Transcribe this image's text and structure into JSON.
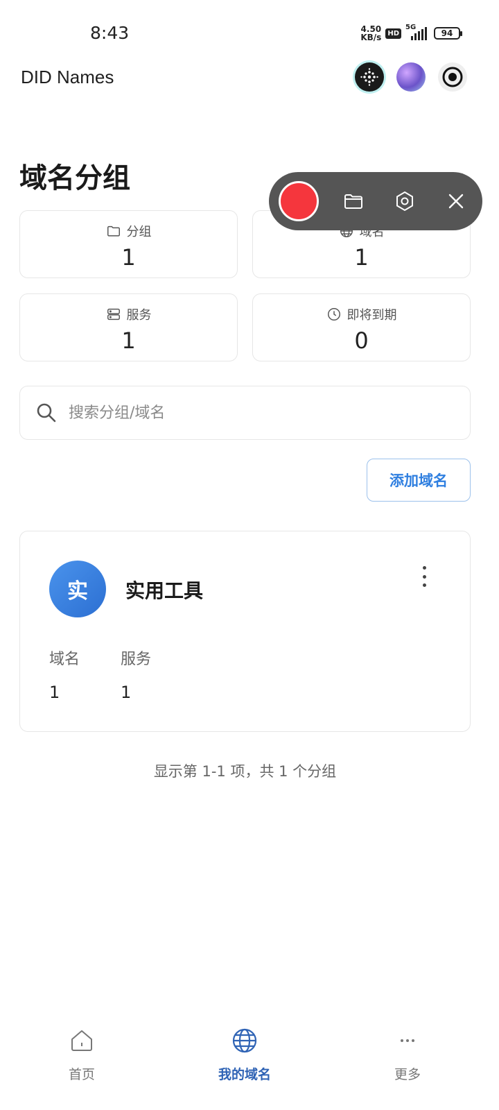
{
  "status_bar": {
    "time": "8:43",
    "net_speed_value": "4.50",
    "net_speed_unit": "KB/s",
    "hd": "HD",
    "network": "5G",
    "battery": "94"
  },
  "header": {
    "title": "DID Names",
    "icons": [
      "dots-app-icon",
      "avatar-icon",
      "record-icon"
    ]
  },
  "page": {
    "title": "域名分组"
  },
  "stats": [
    {
      "label": "分组",
      "value": "1",
      "icon": "folder-icon"
    },
    {
      "label": "域名",
      "value": "1",
      "icon": "globe-icon"
    },
    {
      "label": "服务",
      "value": "1",
      "icon": "server-icon"
    },
    {
      "label": "即将到期",
      "value": "0",
      "icon": "clock-icon"
    }
  ],
  "search": {
    "placeholder": "搜索分组/域名"
  },
  "actions": {
    "add_domain": "添加域名"
  },
  "groups": [
    {
      "avatar_char": "实",
      "name": "实用工具",
      "domains_label": "域名",
      "domains_count": "1",
      "services_label": "服务",
      "services_count": "1"
    }
  ],
  "summary": "显示第 1-1 项，共 1 个分组",
  "recorder": {
    "buttons": [
      "record-button",
      "folder-button",
      "settings-button",
      "close-button"
    ],
    "record_color": "#f5363d"
  },
  "bottom_nav": [
    {
      "label": "首页",
      "icon": "home-icon",
      "active": false
    },
    {
      "label": "我的域名",
      "icon": "globe-icon",
      "active": true
    },
    {
      "label": "更多",
      "icon": "more-icon",
      "active": false
    }
  ],
  "colors": {
    "accent": "#2f7fe0",
    "nav_active": "#2f63b5",
    "avatar_gradient_start": "#4a93ec",
    "avatar_gradient_end": "#2c6fd2"
  }
}
